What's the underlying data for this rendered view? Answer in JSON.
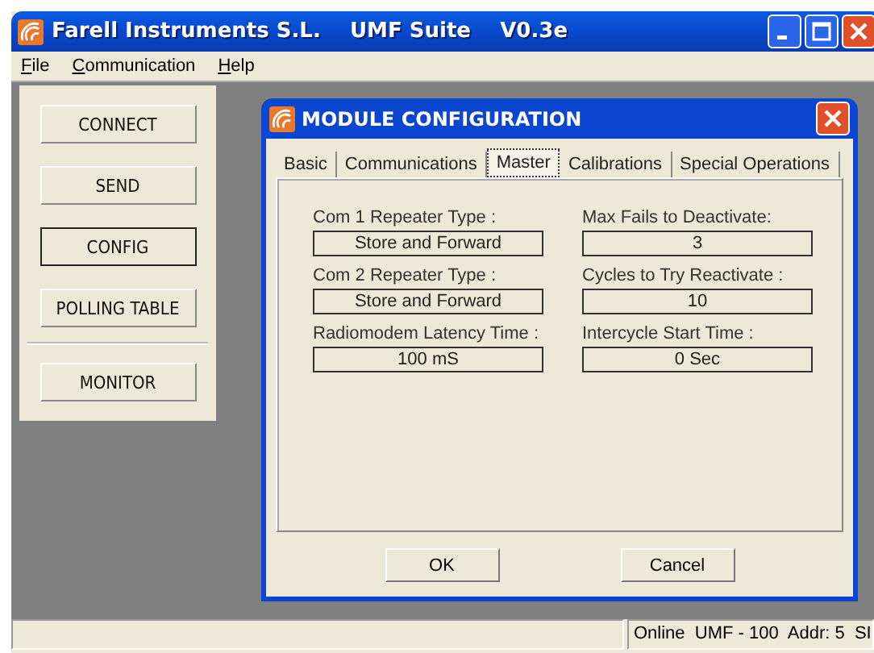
{
  "window": {
    "title": "Farell Instruments S.L.    UMF Suite    V0.3e"
  },
  "menu": [
    {
      "label": "File"
    },
    {
      "label": "Communication"
    },
    {
      "label": "Help"
    }
  ],
  "side_groups": [
    [
      {
        "label": "CONNECT",
        "focused": false
      },
      {
        "label": "SEND",
        "focused": false
      },
      {
        "label": "CONFIG",
        "focused": true
      },
      {
        "label": "POLLING TABLE",
        "focused": false
      }
    ],
    [
      {
        "label": "MONITOR",
        "focused": false
      }
    ]
  ],
  "dialog": {
    "title": "MODULE CONFIGURATION",
    "tabs": [
      {
        "label": "Basic",
        "selected": false
      },
      {
        "label": "Communications",
        "selected": false
      },
      {
        "label": "Master",
        "selected": true
      },
      {
        "label": "Calibrations",
        "selected": false
      },
      {
        "label": "Special Operations",
        "selected": false
      }
    ],
    "fields": [
      {
        "label": "Com 1 Repeater Type :",
        "value": "Store and Forward"
      },
      {
        "label": "Max Fails to Deactivate:",
        "value": "3"
      },
      {
        "label": "Com 2 Repeater Type :",
        "value": "Store and Forward"
      },
      {
        "label": "Cycles to Try Reactivate :",
        "value": "10"
      },
      {
        "label": "Radiomodem Latency Time :",
        "value": "100 mS"
      },
      {
        "label": "Intercycle Start Time :",
        "value": "0 Sec"
      }
    ],
    "buttons": [
      "OK",
      "Cancel"
    ]
  },
  "status_bar": {
    "text": "Online  UMF - 100  Addr: 5  SI"
  }
}
